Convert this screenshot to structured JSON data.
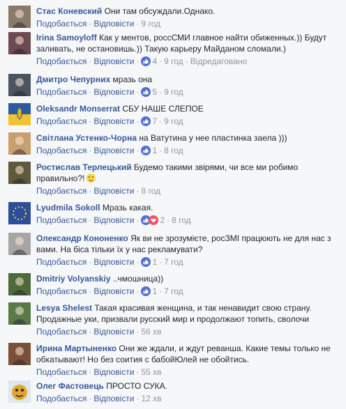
{
  "labels": {
    "like": "Подобається",
    "reply": "Відповісти",
    "edited": "Відредаговано"
  },
  "comments": [
    {
      "author": "Стас Коневский",
      "text": "Они там обсуждали.Однако.",
      "reactions": "",
      "time": "9 год",
      "avatar_color": "#8a7a6a"
    },
    {
      "author": "Irina Samoyloff",
      "text": "Как у ментов, россСМИ главное найти обиженных.)) Будут заливать, не остановишь.)) Такую карьеру Майданом сломали.)",
      "reactions": "4",
      "time": "9 год",
      "edited": true,
      "avatar_color": "#6b4a52"
    },
    {
      "author": "Дмитро Чепурних",
      "text": "мразь она",
      "reactions": "5",
      "time": "9 год",
      "avatar_color": "#4a5560"
    },
    {
      "author": "Oleksandr Monserrat",
      "text": "СБУ НАШЕ СЛЕПОЕ",
      "reactions": "7",
      "time": "9 год",
      "avatar_color": "#2b5a9e"
    },
    {
      "author": "Світлана Устенко-Чорна",
      "text": "на Ватутина у нее пластинка заела )))",
      "reactions": "1",
      "time": "8 год",
      "avatar_color": "#c8a070"
    },
    {
      "author": "Ростислав Терлецький",
      "text": "Будемо такими звірями, чи все ми робимо правильно?!",
      "reactions": "",
      "time": "8 год",
      "smile": true,
      "avatar_color": "#5e5a3e"
    },
    {
      "author": "Lyudmila Sokoll",
      "text": "Мразь какая.",
      "reactions": "2",
      "time": "8 год",
      "multi": true,
      "avatar_color": "#2a4e9a"
    },
    {
      "author": "Олександр Кононенко",
      "text": "Як ви не зрозумієте, росЗМІ працюють не для нас з вами. На біса тільки їх у нас рекламувати?",
      "reactions": "1",
      "time": "7 год",
      "avatar_color": "#a6a6a6"
    },
    {
      "author": "Dmitriy Volyanskiy",
      "text": "..чмошница))",
      "reactions": "1",
      "time": "7 год",
      "avatar_color": "#4d6a3a"
    },
    {
      "author": "Lesya Shelest",
      "text": "Такая красивая женщина, и так ненавидит свою страну. Продажные уки, призвали русский мир и продолжают топить, сволочи",
      "reactions": "",
      "time": "56 хв",
      "avatar_color": "#5a7a4a"
    },
    {
      "author": "Ирина Мартыненко",
      "text": "Они же ждали, и ждут реванша. Какие темы только не обкатывают! Но без соития с бабойЮлей не обойтись.",
      "reactions": "",
      "time": "55 хв",
      "avatar_color": "#7a5038"
    },
    {
      "author": "Олег Фастовець",
      "text": "ПРОСТО СУКА.",
      "reactions": "",
      "time": "12 хв",
      "avatar_color": "#e0a830"
    }
  ],
  "colors": {
    "link": "#365899",
    "meta": "#90949c",
    "like_blue": "#4f70d1",
    "bg": "#f6f7f9"
  }
}
